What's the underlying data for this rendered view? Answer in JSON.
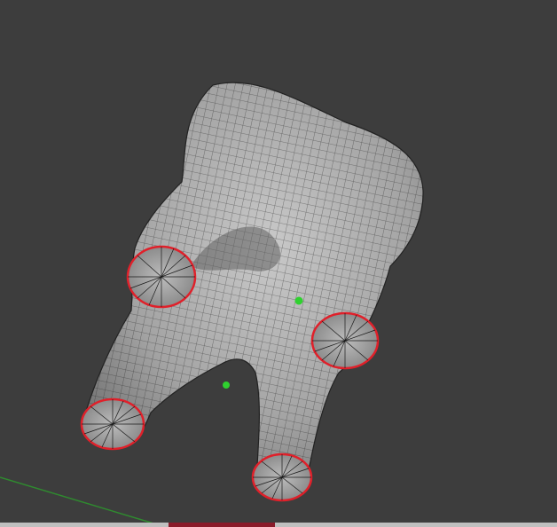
{
  "viewport": {
    "background": "#3d3d3d",
    "mesh_fill": "#9a9a9a",
    "wire_color": "#1a1a1a",
    "boundary_color": "#e0202a",
    "marker_color": "#2fd12f",
    "axis_color": "#2f8a2f"
  },
  "scene": {
    "object": "molar-tooth-mesh",
    "open_boundaries": 4,
    "empties": 2
  }
}
